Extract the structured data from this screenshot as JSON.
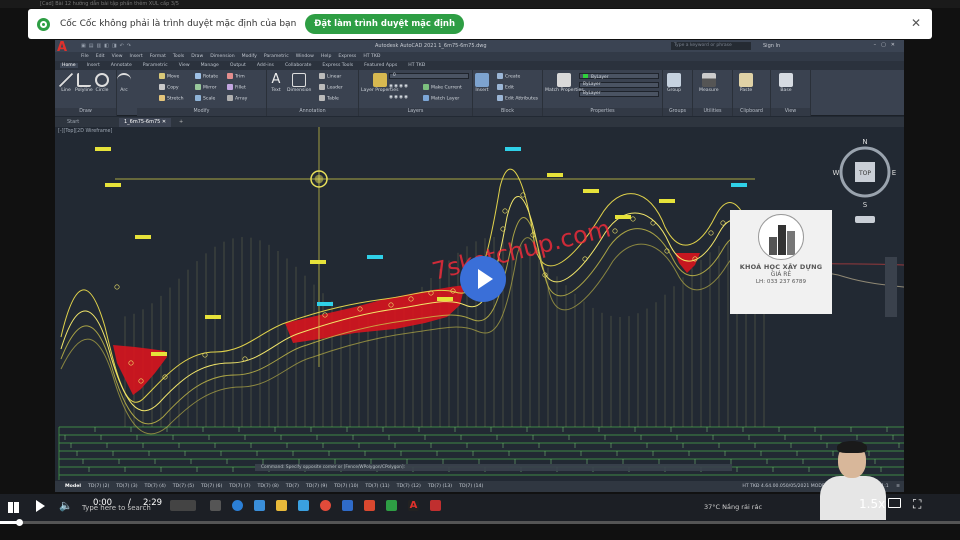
{
  "browser": {
    "tab_title": "[Cad] Bài 12 hướng dẫn bài tập phần thêm XUL cấp 3/5",
    "notification_text": "Cốc Cốc không phải là trình duyệt mặc định của bạn",
    "notification_button": "Đặt làm trình duyệt mặc định",
    "close_symbol": "✕"
  },
  "autocad": {
    "app_title": "Autodesk AutoCAD 2021   1_6m75-6m75.dwg",
    "search_placeholder": "Type a keyword or phrase",
    "sign_in": "Sign In",
    "menu": [
      "File",
      "Edit",
      "View",
      "Insert",
      "Format",
      "Tools",
      "Draw",
      "Dimension",
      "Modify",
      "Parametric",
      "Window",
      "Help",
      "Express",
      "HT TKĐ"
    ],
    "tabs": [
      "Home",
      "Insert",
      "Annotate",
      "Parametric",
      "View",
      "Manage",
      "Output",
      "Add-ins",
      "Collaborate",
      "Express Tools",
      "Featured Apps",
      "HT TKĐ"
    ],
    "active_tab": "Home",
    "draw_tools": [
      "Line",
      "Polyline",
      "Circle",
      "Arc"
    ],
    "modify_tools": [
      "Move",
      "Rotate",
      "Trim",
      "Copy",
      "Mirror",
      "Fillet",
      "Stretch",
      "Scale",
      "Array"
    ],
    "annotation_tools": [
      "Text",
      "Dimension",
      "Linear",
      "Leader",
      "Table"
    ],
    "layer_tools": [
      "Layer Properties",
      "Make Current",
      "Match Layer"
    ],
    "block_tools": [
      "Insert",
      "Create",
      "Edit",
      "Edit Attributes"
    ],
    "properties_tools": [
      "Match Properties",
      "ByLayer",
      "ByLayer",
      "ByLayer"
    ],
    "layer_current": "0",
    "misc_tools": [
      "Group",
      "Measure",
      "Paste",
      "Base"
    ],
    "panel_titles": [
      "Draw",
      "Modify",
      "Annotation",
      "Layers",
      "Block",
      "Properties",
      "Groups",
      "Utilities",
      "Clipboard",
      "View"
    ],
    "file_tabs": [
      "Start",
      "1_6m75-6m75"
    ],
    "viewport_label": "[-][Top][2D Wireframe]",
    "viewcube": {
      "top": "TOP",
      "n": "N",
      "s": "S",
      "e": "E",
      "w": "W"
    },
    "command_line": "Command: Specify opposite corner or [Fence/WPolygon/CPolygon]:",
    "layout_tabs": [
      "Model",
      "TD(7) (2)",
      "TD(7) (3)",
      "TD(7) (4)",
      "TD(7) (5)",
      "TD(7) (6)",
      "TD(7) (7)",
      "TD(7) (8)",
      "TD(7)",
      "TD(7) (9)",
      "TD(7) (10)",
      "TD(7) (11)",
      "TD(7) (12)",
      "TD(7) (13)",
      "TD(7) (14)"
    ],
    "status_right": "HT TKĐ 4.64.00.050/05/2021   MODEL",
    "status_scale": "1:1"
  },
  "ad": {
    "line1": "KHOÁ HỌC XÂY DỰNG",
    "line2": "GIÁ RẺ",
    "line3": "LH: 033 237 6789"
  },
  "watermark": "7sketchup.com",
  "taskbar": {
    "search_placeholder": "Type here to search",
    "weather": "37°C  Nắng rải rác"
  },
  "player": {
    "current_time": "0:00",
    "separator": "/",
    "total_time": "2:29",
    "speed": "1.5x",
    "progress_fraction": 0.02
  },
  "colors": {
    "notify_green": "#2e9e44",
    "cut_fill_red": "#d8141e",
    "alignment_yellow": "#d6d64a",
    "play_blue": "#3a6fd8",
    "canvas_bg": "#222933"
  }
}
